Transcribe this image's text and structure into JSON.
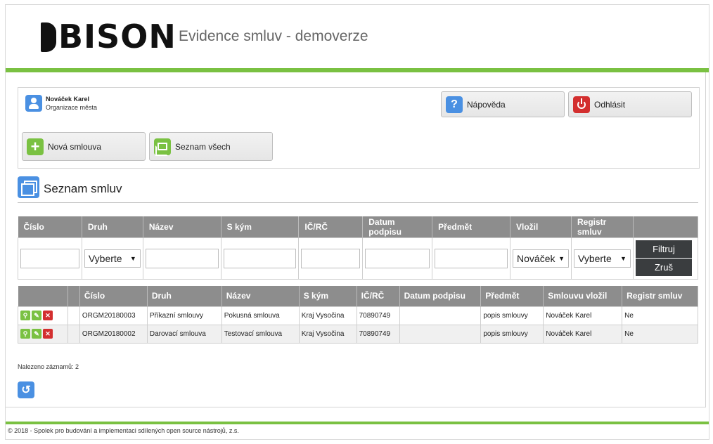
{
  "header": {
    "logo_text": "BISON",
    "app_title": "Evidence smluv - demoverze"
  },
  "user": {
    "name": "Nováček Karel",
    "organization": "Organizace města",
    "icon": "user-icon"
  },
  "top_buttons": {
    "help_label": "Nápověda",
    "logout_label": "Odhlásit",
    "new_contract_label": "Nová smlouva",
    "all_list_label": "Seznam všech"
  },
  "section": {
    "title": "Seznam smluv",
    "icon": "windows-icon"
  },
  "filter": {
    "headers": [
      "Číslo",
      "Druh",
      "Název",
      "S kým",
      "IČ/RČ",
      "Datum podpisu",
      "Předmět",
      "Vložil",
      "Registr smluv"
    ],
    "druh_selected": "Vyberte",
    "vlozil_selected": "Nováček",
    "registr_selected": "Vyberte",
    "filter_button": "Filtruj",
    "reset_button": "Zruš"
  },
  "table": {
    "headers": [
      "Číslo",
      "Druh",
      "Název",
      "S kým",
      "IČ/RČ",
      "Datum podpisu",
      "Předmět",
      "Smlouvu vložil",
      "Registr smluv"
    ],
    "rows": [
      {
        "cislo": "ORGM20180003",
        "druh": "Příkazní smlouvy",
        "nazev": "Pokusná smlouva",
        "s_kym": "Kraj Vysočina",
        "ic": "70890749",
        "datum": "",
        "predmet": "popis smlouvy",
        "vlozil": "Nováček Karel",
        "registr": "Ne"
      },
      {
        "cislo": "ORGM20180002",
        "druh": "Darovací smlouva",
        "nazev": "Testovací smlouva",
        "s_kym": "Kraj Vysočina",
        "ic": "70890749",
        "datum": "",
        "predmet": "popis smlouvy",
        "vlozil": "Nováček Karel",
        "registr": "Ne"
      }
    ]
  },
  "found_text": "Nalezeno záznamů: 2",
  "footer_text": "© 2018 - Spolek pro budování a implementaci sdílených open source nástrojů, z.s.",
  "colors": {
    "accent_green": "#7ac142",
    "accent_blue": "#4a90e2",
    "danger_red": "#d32f2f",
    "header_gray": "#8d8d8d",
    "button_dark": "#3a3d3f"
  }
}
